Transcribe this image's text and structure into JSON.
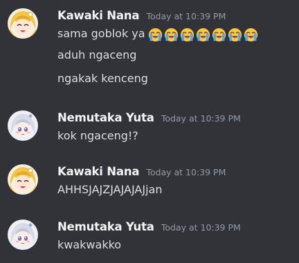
{
  "messages": [
    {
      "username": "Kawaki Nana",
      "timestamp": "Today at 10:39 PM",
      "avatar_icon": "blonde-anime-girl-avatar",
      "lines": [
        {
          "text": "sama goblok ya",
          "emoji": "loudly-crying-face",
          "emoji_count": 7
        },
        {
          "text": "aduh ngaceng"
        },
        {
          "text": "ngakak kenceng"
        }
      ]
    },
    {
      "username": "Nemutaka Yuta",
      "timestamp": "Today at 10:39 PM",
      "avatar_icon": "silver-hair-anime-girl-avatar",
      "lines": [
        {
          "text": "kok ngaceng!?"
        }
      ]
    },
    {
      "username": "Kawaki Nana",
      "timestamp": "Today at 10:39 PM",
      "avatar_icon": "blonde-anime-girl-avatar",
      "lines": [
        {
          "text": "AHHSJAJZJAJAJAJjan"
        }
      ]
    },
    {
      "username": "Nemutaka Yuta",
      "timestamp": "Today at 10:39 PM",
      "avatar_icon": "silver-hair-anime-girl-avatar",
      "lines": [
        {
          "text": "kwakwakko"
        }
      ]
    }
  ],
  "colors": {
    "background": "#313338",
    "username": "#f2f3f5",
    "timestamp": "#949ba4",
    "message_text": "#dbdee1",
    "emoji_face": "#ffc83d",
    "emoji_tears": "#4aa8ff"
  }
}
